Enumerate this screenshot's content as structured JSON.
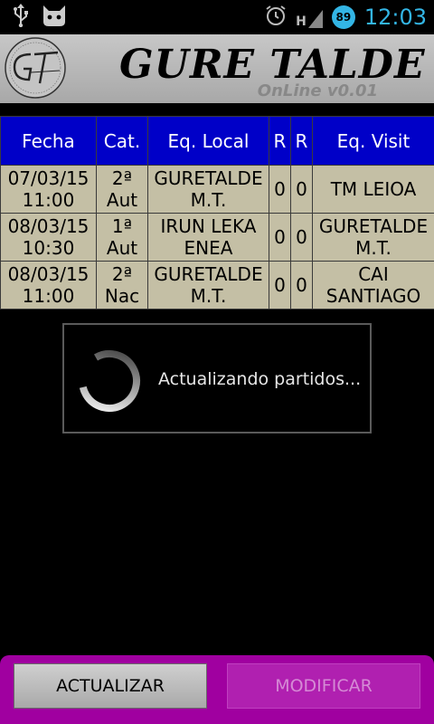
{
  "status_bar": {
    "clock": "12:03",
    "battery_level": "89",
    "signal_type": "H",
    "icons": [
      "usb-icon",
      "cat-icon",
      "alarm-icon",
      "signal-icon",
      "battery-icon"
    ]
  },
  "header": {
    "title": "GURE TALDE",
    "subtitle": "OnLine v0.01",
    "logo_icon": "gure-talde-logo"
  },
  "table": {
    "columns": [
      "Fecha",
      "Cat.",
      "Eq. Local",
      "R",
      "R",
      "Eq. Visit"
    ],
    "rows": [
      {
        "date": "07/03/15",
        "time": "11:00",
        "cat1": "2ª",
        "cat2": "Aut",
        "local1": "GURETALDE",
        "local2": "M.T.",
        "r1": "0",
        "r2": "0",
        "visit1": "TM LEIOA",
        "visit2": ""
      },
      {
        "date": "08/03/15",
        "time": "10:30",
        "cat1": "1ª",
        "cat2": "Aut",
        "local1": "IRUN LEKA",
        "local2": "ENEA",
        "r1": "0",
        "r2": "0",
        "visit1": "GURETALDE",
        "visit2": "M.T."
      },
      {
        "date": "08/03/15",
        "time": "11:00",
        "cat1": "2ª",
        "cat2": "Nac",
        "local1": "GURETALDE",
        "local2": "M.T.",
        "r1": "0",
        "r2": "0",
        "visit1": "CAI",
        "visit2": "SANTIAGO"
      }
    ]
  },
  "dialog": {
    "message": "Actualizando partidos..."
  },
  "buttons": {
    "update_label": "ACTUALIZAR",
    "modify_label": "MODIFICAR"
  },
  "colors": {
    "header_bg": "#b4b4b4",
    "table_header_bg": "#0000c8",
    "table_cell_bg": "#c4bfa5",
    "bottom_bar_bg": "#a000a0",
    "clock": "#33b5e5"
  }
}
